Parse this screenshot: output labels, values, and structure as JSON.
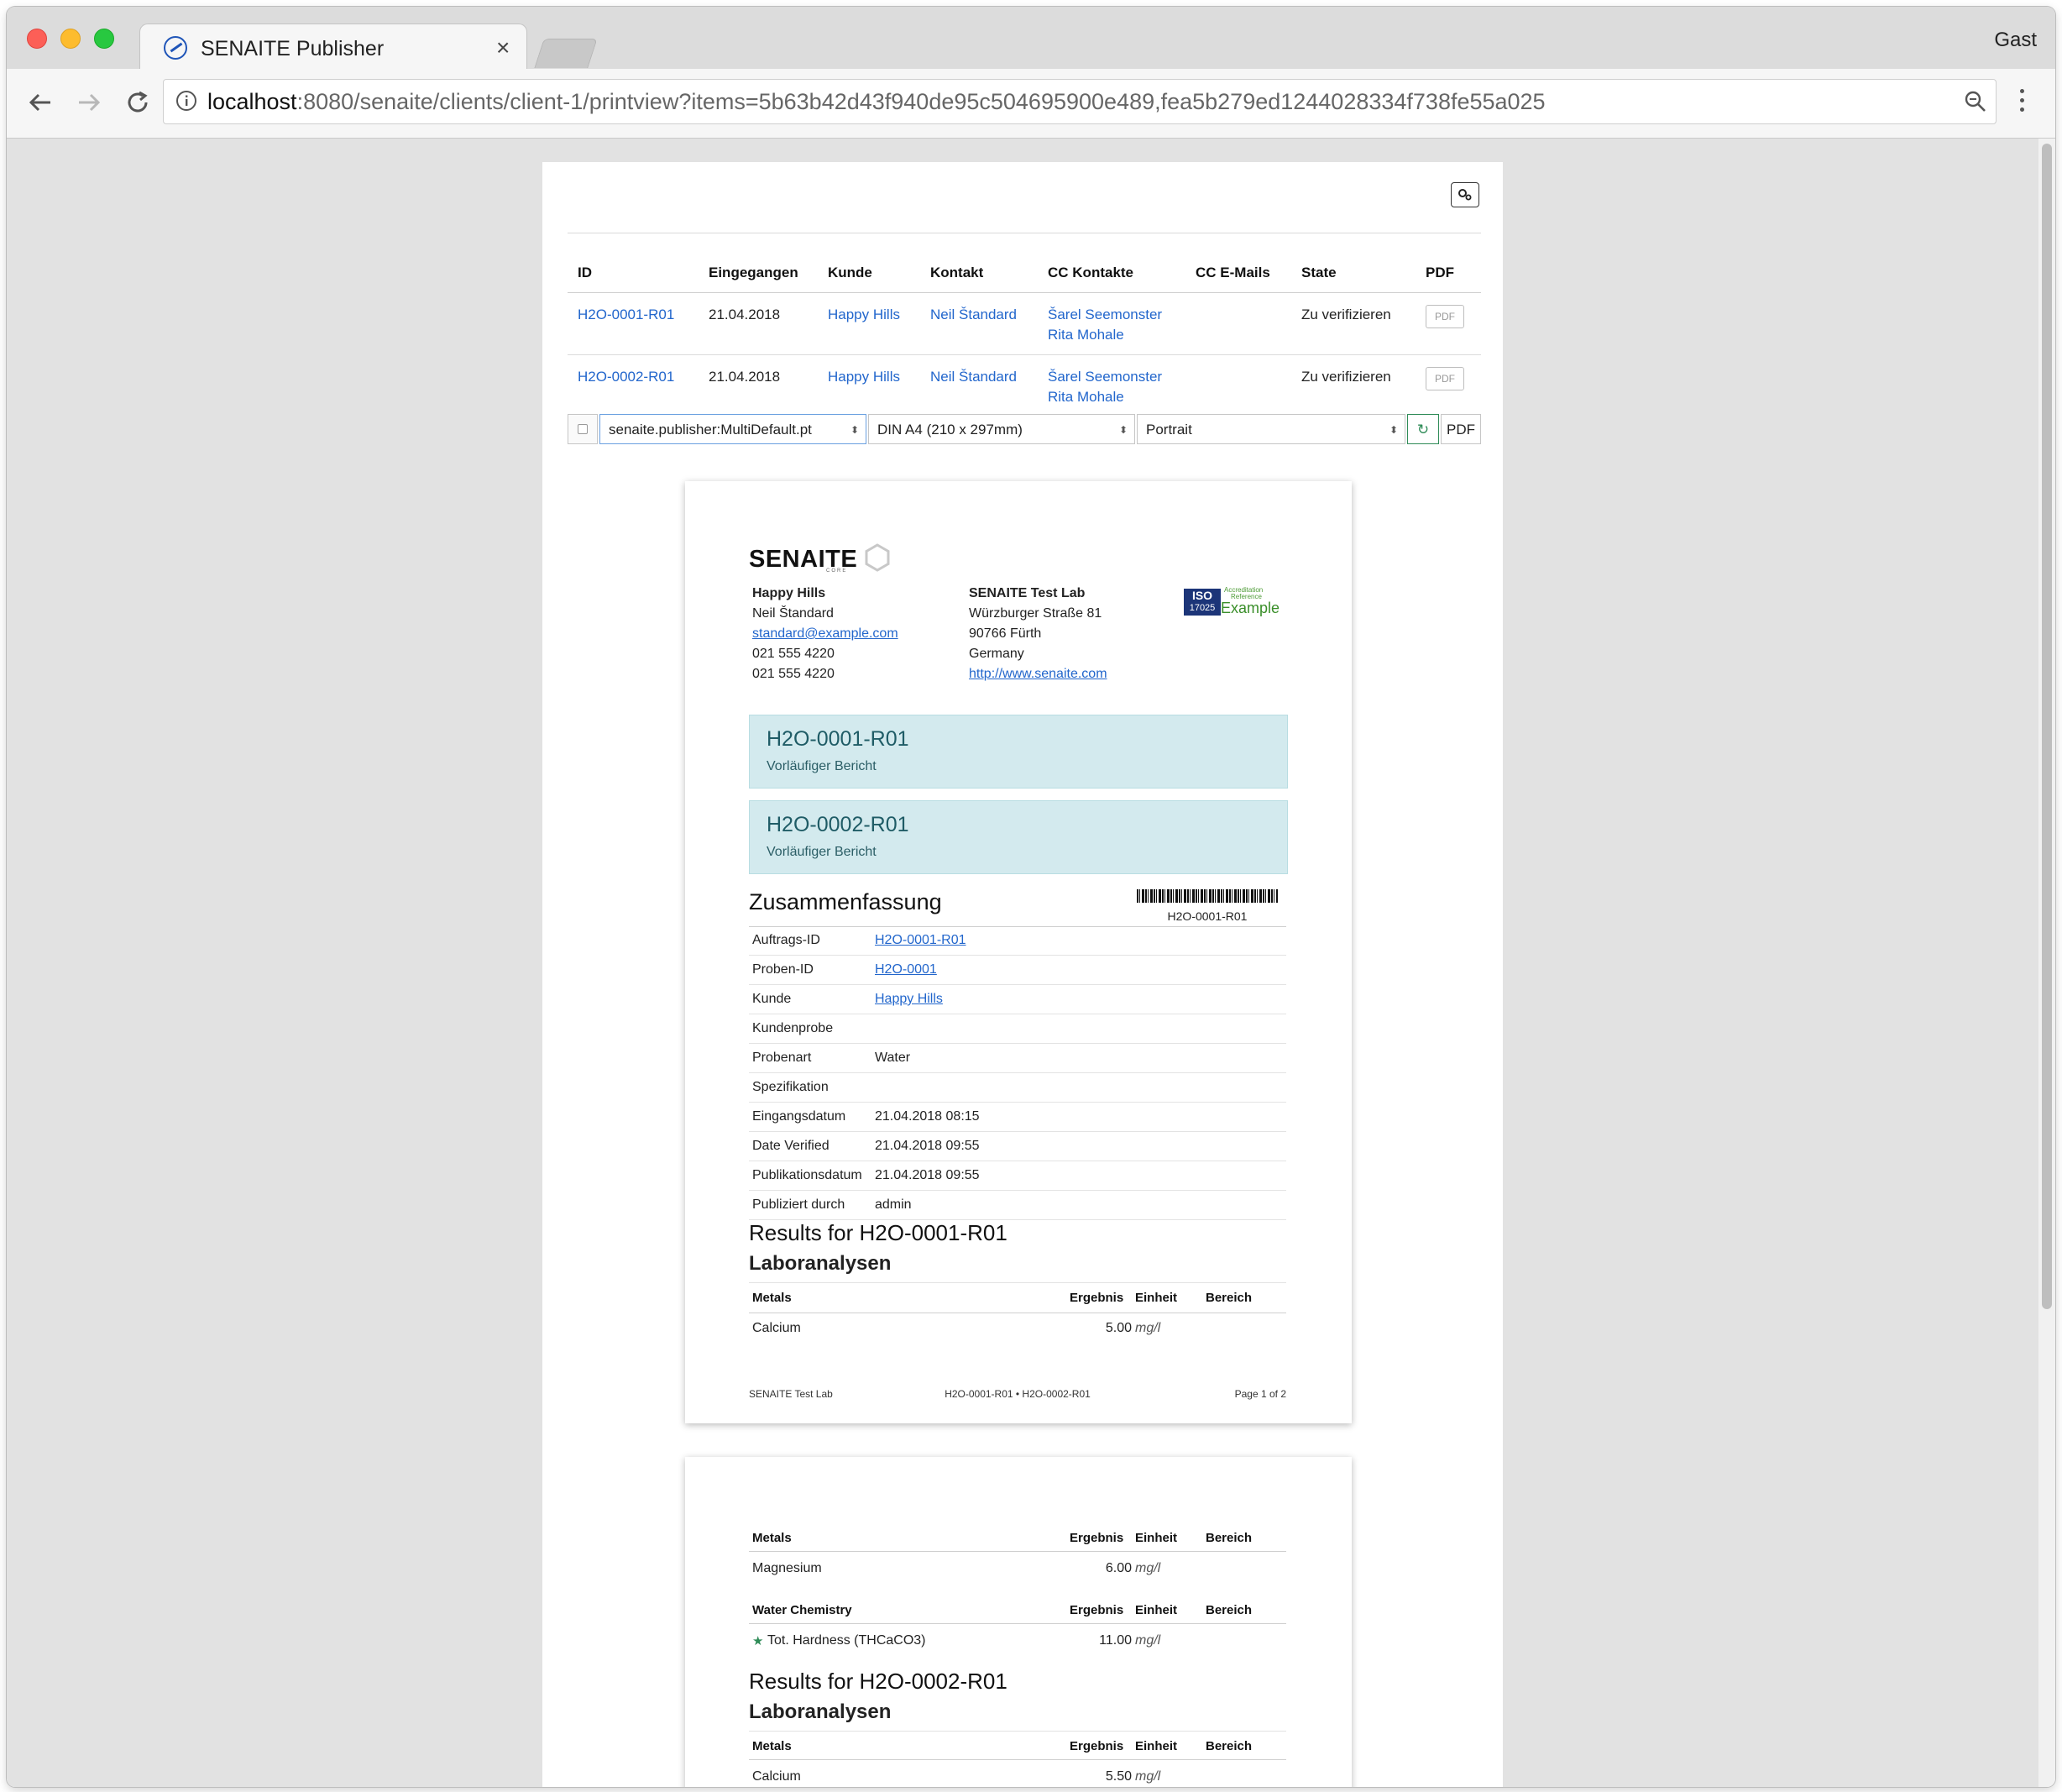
{
  "browser": {
    "tab_title": "SENAITE Publisher",
    "tab_close": "×",
    "profile": "Gast",
    "url_host": "localhost",
    "url_path": ":8080/senaite/clients/client-1/printview?items=5b63b42d43f940de95c504695900e489,fea5b279ed1244028334f738fe55a025"
  },
  "publisher": {
    "columns": [
      "ID",
      "Eingegangen",
      "Kunde",
      "Kontakt",
      "CC Kontakte",
      "CC E-Mails",
      "State",
      "PDF"
    ],
    "rows": [
      {
        "id": "H2O-0001-R01",
        "received": "21.04.2018",
        "client": "Happy Hills",
        "contact": "Neil Štandard",
        "cc1": "Šarel Seemonster",
        "cc2": "Rita Mohale",
        "cc_emails": "",
        "state": "Zu verifizieren",
        "pdf": "PDF"
      },
      {
        "id": "H2O-0002-R01",
        "received": "21.04.2018",
        "client": "Happy Hills",
        "contact": "Neil Štandard",
        "cc1": "Šarel Seemonster",
        "cc2": "Rita Mohale",
        "cc_emails": "",
        "state": "Zu verifizieren",
        "pdf": "PDF"
      }
    ],
    "template": "senaite.publisher:MultiDefault.pt",
    "paperformat": "DIN A4 (210 x 297mm)",
    "orientation": "Portrait",
    "pdf_button": "PDF"
  },
  "report": {
    "logo_text": "SENAITE",
    "logo_sub": "CORE",
    "client": {
      "name": "Happy Hills",
      "contact": "Neil Štandard",
      "email": "standard@example.com",
      "phone": "021 555 4220",
      "fax": "021 555 4220"
    },
    "lab": {
      "name": "SENAITE Test Lab",
      "street": "Würzburger Straße 81",
      "city": "90766 Fürth",
      "country": "Germany",
      "url": "http://www.senaite.com"
    },
    "accreditation": {
      "iso": "ISO",
      "iso_num": "17025",
      "line1": "Accreditation",
      "line2": "Reference",
      "example": "Example"
    },
    "samples": [
      {
        "id": "H2O-0001-R01",
        "status": "Vorläufiger Bericht"
      },
      {
        "id": "H2O-0002-R01",
        "status": "Vorläufiger Bericht"
      }
    ],
    "summary_title": "Zusammenfassung",
    "barcode_text": "H2O-0001-R01",
    "summary": [
      {
        "key": "Auftrags-ID",
        "value": "H2O-0001-R01",
        "link": true
      },
      {
        "key": "Proben-ID",
        "value": "H2O-0001",
        "link": true
      },
      {
        "key": "Kunde",
        "value": "Happy Hills",
        "link": true
      },
      {
        "key": "Kundenprobe",
        "value": "",
        "link": false
      },
      {
        "key": "Probenart",
        "value": "Water",
        "link": false
      },
      {
        "key": "Spezifikation",
        "value": "",
        "link": false
      },
      {
        "key": "Eingangsdatum",
        "value": "21.04.2018 08:15",
        "link": false
      },
      {
        "key": "Date Verified",
        "value": "21.04.2018 09:55",
        "link": false
      },
      {
        "key": "Publikationsdatum",
        "value": "21.04.2018 09:55",
        "link": false
      },
      {
        "key": "Publiziert durch",
        "value": "admin",
        "link": false
      }
    ],
    "results_heading_1": "Results for H2O-0001-R01",
    "lab_analyses": "Laboranalysen",
    "col_result": "Ergebnis",
    "col_unit": "Einheit",
    "col_range": "Bereich",
    "page1_group": "Metals",
    "page1_rows": [
      {
        "name": "Calcium",
        "result": "5.00",
        "unit": "mg/l"
      }
    ],
    "footer_left": "SENAITE Test Lab",
    "footer_mid": "H2O-0001-R01 • H2O-0002-R01",
    "footer_right": "Page 1 of 2",
    "page2_group_a": "Metals",
    "page2_rows_a": [
      {
        "name": "Magnesium",
        "result": "6.00",
        "unit": "mg/l"
      }
    ],
    "page2_group_b": "Water Chemistry",
    "page2_rows_b": [
      {
        "star": "★",
        "name": "Tot. Hardness (THCaCO3)",
        "result": "11.00",
        "unit": "mg/l"
      }
    ],
    "results_heading_2": "Results for H2O-0002-R01",
    "page2_group_c": "Metals",
    "page2_rows_c": [
      {
        "name": "Calcium",
        "result": "5.50",
        "unit": "mg/l"
      }
    ]
  },
  "colors": {
    "link": "#2266cc",
    "band": "#d3eaee",
    "refresh": "#2e8b57"
  }
}
